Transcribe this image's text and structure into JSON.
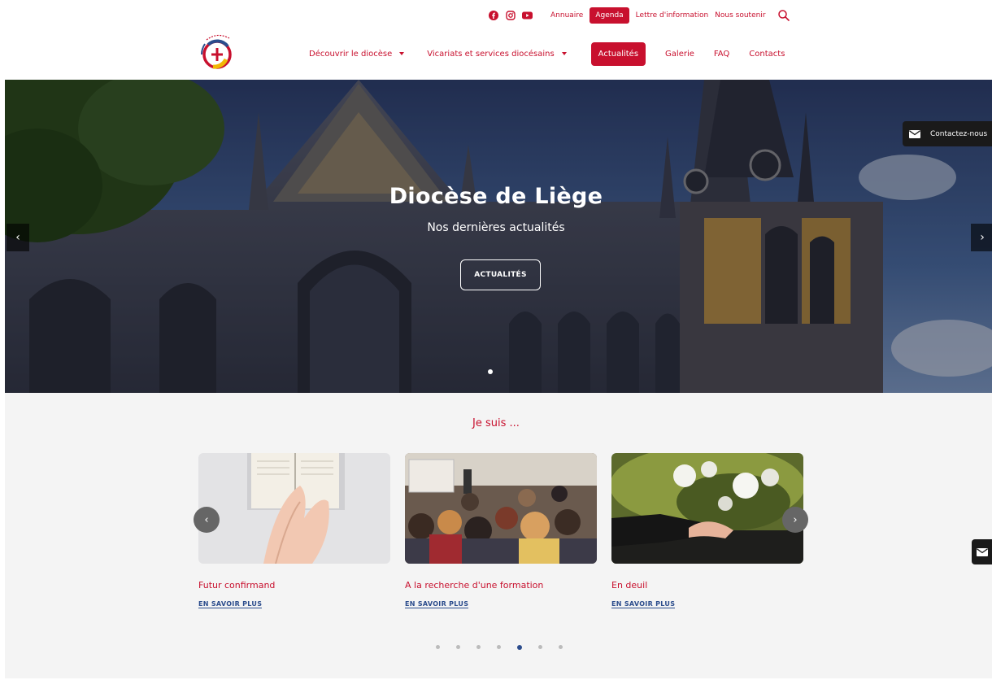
{
  "topbar": {
    "links": [
      "Annuaire",
      "Agenda",
      "Lettre d'information",
      "Nous soutenir"
    ],
    "social": [
      "facebook-icon",
      "instagram-icon",
      "youtube-icon"
    ]
  },
  "nav": {
    "items": [
      "Découvrir le diocèse",
      "Vicariats et services diocésains",
      "Actualités",
      "Galerie",
      "FAQ",
      "Contacts"
    ]
  },
  "hero": {
    "title": "Diocèse de Liège",
    "subtitle": "Nos dernières actualités",
    "button": "ACTUALITÉS",
    "prev": "‹",
    "next": "›"
  },
  "contact": {
    "label": "Contactez-nous"
  },
  "section": {
    "title": "Je suis ...",
    "cards": [
      {
        "title": "Futur confirmand",
        "more": "EN SAVOIR PLUS"
      },
      {
        "title": "A la recherche d'une formation",
        "more": "EN SAVOIR PLUS"
      },
      {
        "title": "En deuil",
        "more": "EN SAVOIR PLUS"
      }
    ],
    "prev": "‹",
    "next": "›",
    "page_count": 7,
    "active_page": 5
  },
  "colors": {
    "accent": "#c8102e",
    "link": "#2b4c8c",
    "dark": "#1a1a1a"
  }
}
